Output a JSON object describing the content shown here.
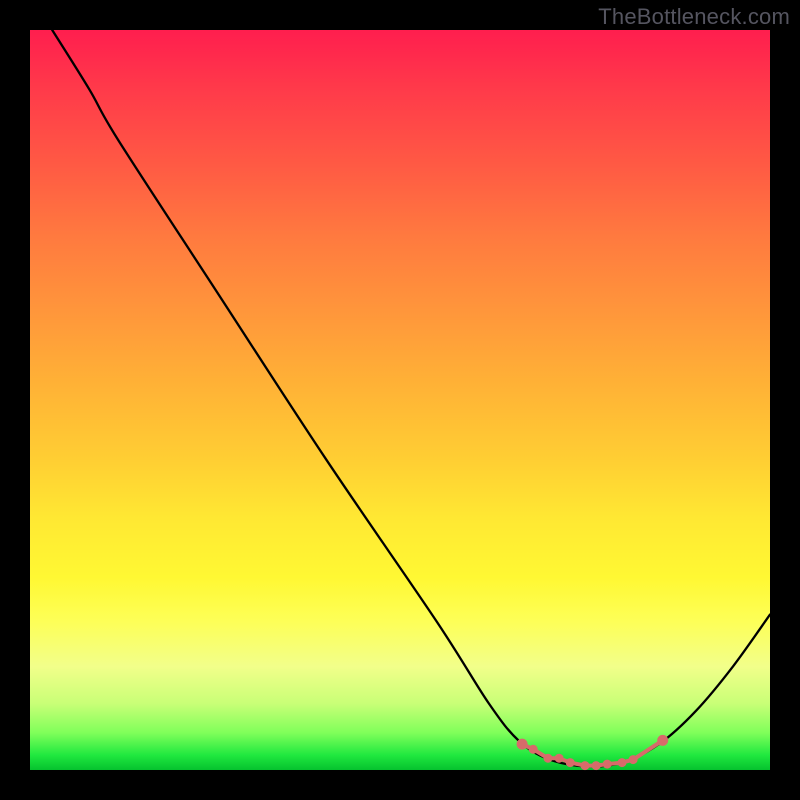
{
  "watermark": "TheBottleneck.com",
  "chart_data": {
    "type": "line",
    "title": "",
    "xlabel": "",
    "ylabel": "",
    "xlim": [
      0,
      100
    ],
    "ylim": [
      0,
      100
    ],
    "curve_points": [
      {
        "x": 3,
        "y": 100
      },
      {
        "x": 8,
        "y": 92
      },
      {
        "x": 12,
        "y": 85
      },
      {
        "x": 25,
        "y": 65
      },
      {
        "x": 40,
        "y": 42
      },
      {
        "x": 55,
        "y": 20
      },
      {
        "x": 62,
        "y": 9
      },
      {
        "x": 66,
        "y": 4
      },
      {
        "x": 70,
        "y": 1.5
      },
      {
        "x": 75,
        "y": 0.5
      },
      {
        "x": 80,
        "y": 1
      },
      {
        "x": 85,
        "y": 3.5
      },
      {
        "x": 90,
        "y": 8
      },
      {
        "x": 95,
        "y": 14
      },
      {
        "x": 100,
        "y": 21
      }
    ],
    "valley_markers": [
      {
        "x": 66.5,
        "y": 3.5
      },
      {
        "x": 68,
        "y": 2.8
      },
      {
        "x": 70,
        "y": 1.6
      },
      {
        "x": 71.5,
        "y": 1.6
      },
      {
        "x": 73,
        "y": 1.0
      },
      {
        "x": 75,
        "y": 0.6
      },
      {
        "x": 76.5,
        "y": 0.6
      },
      {
        "x": 78,
        "y": 0.8
      },
      {
        "x": 80,
        "y": 1.0
      },
      {
        "x": 81.5,
        "y": 1.4
      },
      {
        "x": 85.5,
        "y": 4.0
      }
    ],
    "background_gradient": {
      "top": "#ff1e4e",
      "mid": "#ffe833",
      "bottom": "#05c22e"
    }
  }
}
